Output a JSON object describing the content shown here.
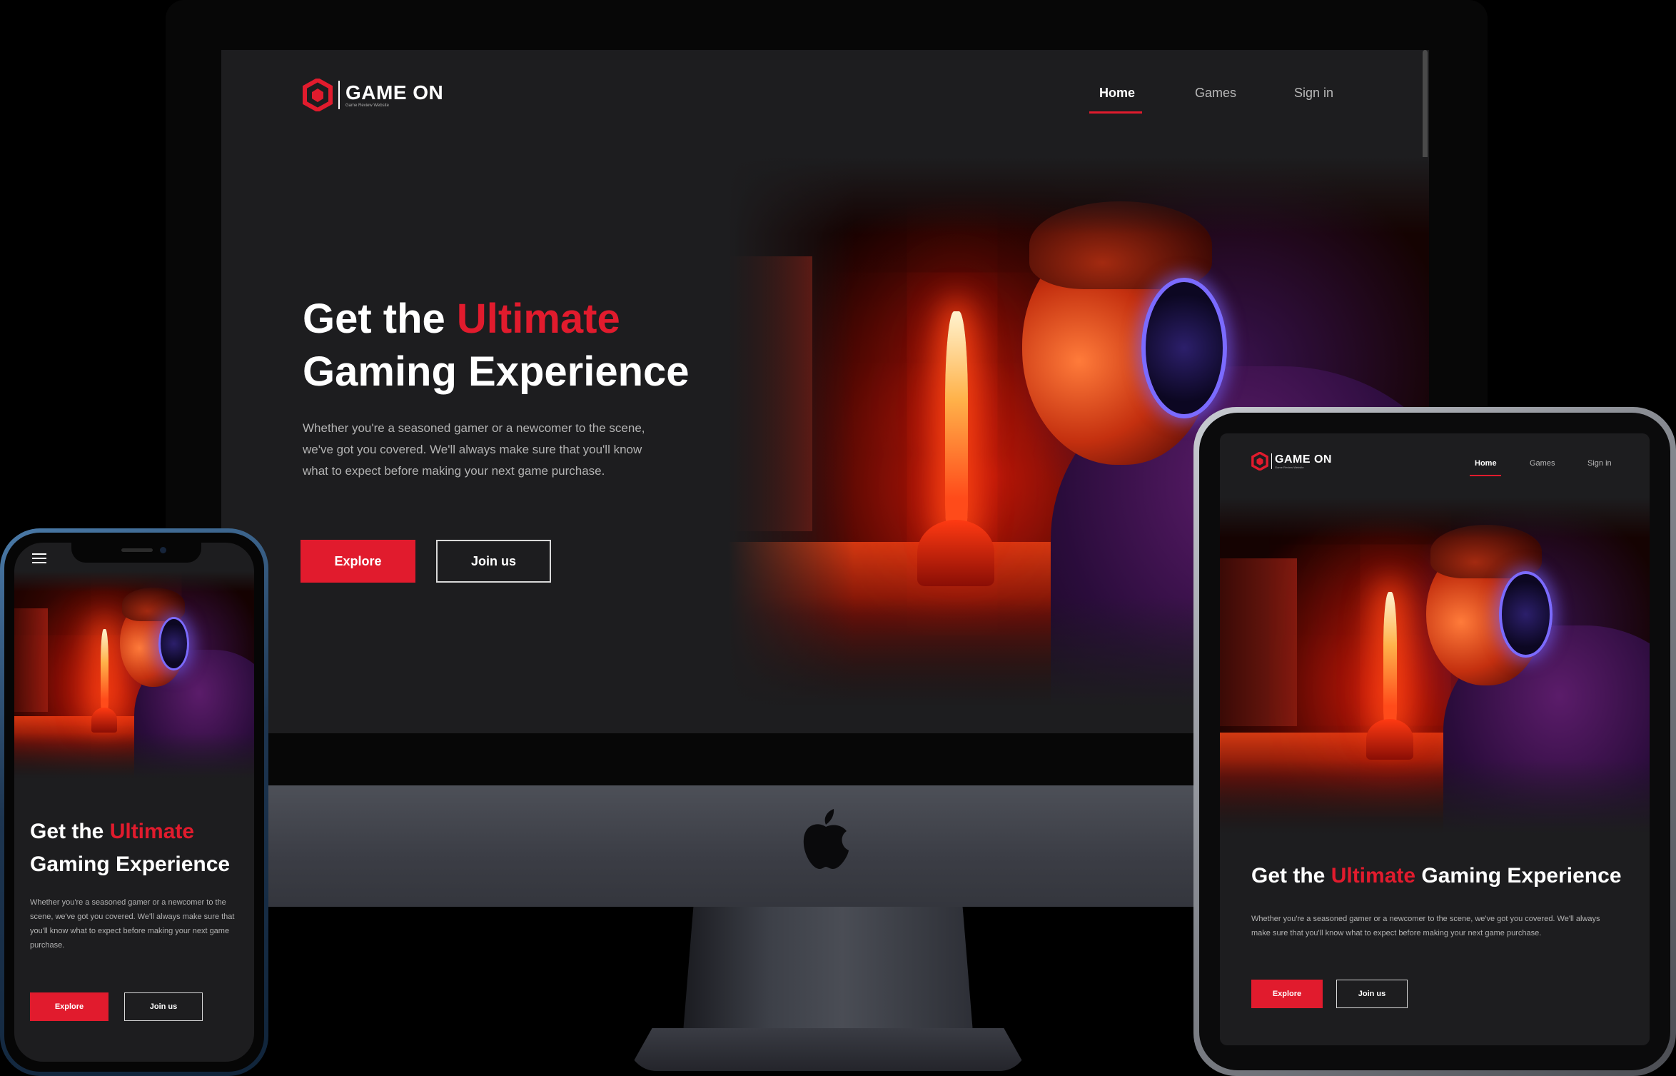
{
  "brand": {
    "name": "GAME ON",
    "tagline": "Game Review Website"
  },
  "nav": {
    "items": [
      "Home",
      "Games",
      "Sign in"
    ],
    "active": "Home"
  },
  "hero": {
    "title_before": "Get the ",
    "title_accent": "Ultimate",
    "title_after": "Gaming Experience",
    "description": "Whether you're a seasoned gamer or a newcomer to the scene, we've got you covered. We'll always make sure that you'll know what to expect before making your next game purchase.",
    "primary_button": "Explore",
    "secondary_button": "Join us"
  },
  "colors": {
    "accent": "#e11b2d",
    "background": "#1d1d1f",
    "text": "#ffffff",
    "muted_text": "#b3b3b3"
  },
  "icons": [
    "hexagon-logo-icon",
    "hamburger-menu-icon",
    "apple-logo-icon"
  ]
}
